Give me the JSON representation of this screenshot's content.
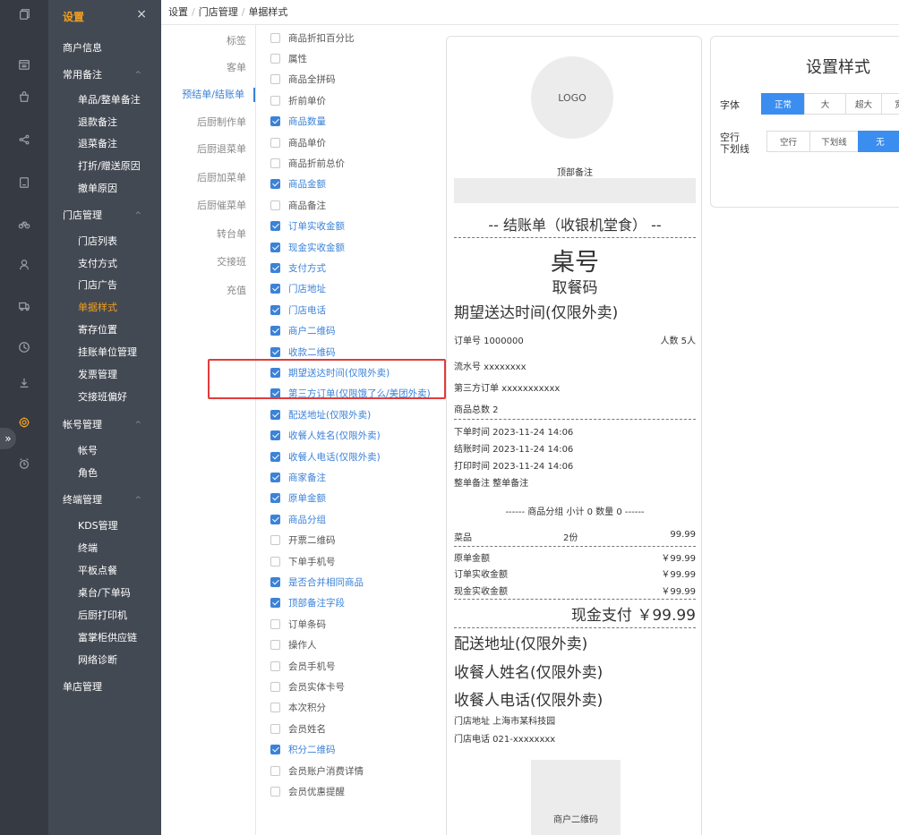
{
  "menu": {
    "title": "设置",
    "close": "×",
    "items": [
      {
        "label": "商户信息",
        "level": "group",
        "caret": "",
        "active": false
      },
      {
        "label": "常用备注",
        "level": "group",
        "caret": "^",
        "active": false
      },
      {
        "label": "单品/整单备注",
        "level": "sub",
        "caret": "",
        "active": false
      },
      {
        "label": "退款备注",
        "level": "sub",
        "caret": "",
        "active": false
      },
      {
        "label": "退菜备注",
        "level": "sub",
        "caret": "",
        "active": false
      },
      {
        "label": "打折/赠送原因",
        "level": "sub",
        "caret": "",
        "active": false
      },
      {
        "label": "撤单原因",
        "level": "sub",
        "caret": "",
        "active": false
      },
      {
        "label": "门店管理",
        "level": "group",
        "caret": "^",
        "active": false
      },
      {
        "label": "门店列表",
        "level": "sub",
        "caret": "",
        "active": false
      },
      {
        "label": "支付方式",
        "level": "sub",
        "caret": "",
        "active": false
      },
      {
        "label": "门店广告",
        "level": "sub",
        "caret": "",
        "active": false
      },
      {
        "label": "单据样式",
        "level": "sub",
        "caret": "",
        "active": true
      },
      {
        "label": "寄存位置",
        "level": "sub",
        "caret": "",
        "active": false
      },
      {
        "label": "挂账单位管理",
        "level": "sub",
        "caret": "",
        "active": false
      },
      {
        "label": "发票管理",
        "level": "sub",
        "caret": "",
        "active": false
      },
      {
        "label": "交接班偏好",
        "level": "sub",
        "caret": "",
        "active": false
      },
      {
        "label": "帐号管理",
        "level": "group",
        "caret": "^",
        "active": false
      },
      {
        "label": "帐号",
        "level": "sub",
        "caret": "",
        "active": false
      },
      {
        "label": "角色",
        "level": "sub",
        "caret": "",
        "active": false
      },
      {
        "label": "终端管理",
        "level": "group",
        "caret": "^",
        "active": false
      },
      {
        "label": "KDS管理",
        "level": "sub",
        "caret": "",
        "active": false
      },
      {
        "label": "终端",
        "level": "sub",
        "caret": "",
        "active": false
      },
      {
        "label": "平板点餐",
        "level": "sub",
        "caret": "",
        "active": false
      },
      {
        "label": "桌台/下单码",
        "level": "sub",
        "caret": "",
        "active": false
      },
      {
        "label": "后厨打印机",
        "level": "sub",
        "caret": "",
        "active": false
      },
      {
        "label": "富掌柜供应链",
        "level": "sub",
        "caret": "",
        "active": false
      },
      {
        "label": "网络诊断",
        "level": "sub",
        "caret": "",
        "active": false
      },
      {
        "label": "单店管理",
        "level": "group",
        "caret": "",
        "active": false
      }
    ]
  },
  "rail": {
    "icons": [
      "copy-icon",
      "calendar-icon",
      "bag-icon",
      "share-icon",
      "bookmark-icon",
      "bike-icon",
      "user-icon",
      "truck-icon",
      "clock-icon",
      "download-icon",
      "gear-icon",
      "alarm-icon"
    ],
    "active_icon": "gear-icon",
    "expander": "»"
  },
  "breadcrumb": [
    "设置",
    "门店管理",
    "单据样式"
  ],
  "tabs": [
    {
      "label": "标签",
      "active": false
    },
    {
      "label": "客单",
      "active": false
    },
    {
      "label": "预结单/结账单",
      "active": true
    },
    {
      "label": "后厨制作单",
      "active": false
    },
    {
      "label": "后厨退菜单",
      "active": false
    },
    {
      "label": "后厨加菜单",
      "active": false
    },
    {
      "label": "后厨催菜单",
      "active": false
    },
    {
      "label": "转台单",
      "active": false
    },
    {
      "label": "交接班",
      "active": false
    },
    {
      "label": "充值",
      "active": false
    }
  ],
  "checklist": [
    {
      "label": "商品折扣百分比",
      "checked": false
    },
    {
      "label": "属性",
      "checked": false
    },
    {
      "label": "商品全拼码",
      "checked": false
    },
    {
      "label": "折前单价",
      "checked": false
    },
    {
      "label": "商品数量",
      "checked": true
    },
    {
      "label": "商品单价",
      "checked": false
    },
    {
      "label": "商品折前总价",
      "checked": false
    },
    {
      "label": "商品金额",
      "checked": true
    },
    {
      "label": "商品备注",
      "checked": false
    },
    {
      "label": "订单实收金额",
      "checked": true
    },
    {
      "label": "现金实收金额",
      "checked": true
    },
    {
      "label": "支付方式",
      "checked": true
    },
    {
      "label": "门店地址",
      "checked": true
    },
    {
      "label": "门店电话",
      "checked": true
    },
    {
      "label": "商户二维码",
      "checked": true
    },
    {
      "label": "收款二维码",
      "checked": true
    },
    {
      "label": "期望送达时间(仅限外卖)",
      "checked": true
    },
    {
      "label": "第三方订单(仅限饿了么/美团外卖)",
      "checked": true
    },
    {
      "label": "配送地址(仅限外卖)",
      "checked": true
    },
    {
      "label": "收餐人姓名(仅限外卖)",
      "checked": true
    },
    {
      "label": "收餐人电话(仅限外卖)",
      "checked": true
    },
    {
      "label": "商家备注",
      "checked": true
    },
    {
      "label": "原单金额",
      "checked": true
    },
    {
      "label": "商品分组",
      "checked": true
    },
    {
      "label": "开票二维码",
      "checked": false
    },
    {
      "label": "下单手机号",
      "checked": false
    },
    {
      "label": "是否合并相同商品",
      "checked": true
    },
    {
      "label": "顶部备注字段",
      "checked": true
    },
    {
      "label": "订单条码",
      "checked": false
    },
    {
      "label": "操作人",
      "checked": false
    },
    {
      "label": "会员手机号",
      "checked": false
    },
    {
      "label": "会员实体卡号",
      "checked": false
    },
    {
      "label": "本次积分",
      "checked": false
    },
    {
      "label": "会员姓名",
      "checked": false
    },
    {
      "label": "积分二维码",
      "checked": true
    },
    {
      "label": "会员账户消费详情",
      "checked": false
    },
    {
      "label": "会员优惠提醒",
      "checked": false
    }
  ],
  "receipt": {
    "logo": "LOGO",
    "top_note": "顶部备注",
    "title": "-- 结账单（收银机堂食） --",
    "table_no": "桌号",
    "pickup_code": "取餐码",
    "expected_time": "期望送达时间(仅限外卖)",
    "order_no": "订单号 1000000",
    "people": "人数 5人",
    "serial": "流水号 xxxxxxxx",
    "third_party": "第三方订单 xxxxxxxxxxx",
    "total_items": "商品总数 2",
    "order_time": "下单时间 2023-11-24 14:06",
    "checkout_time": "结账时间 2023-11-24 14:06",
    "print_time": "打印时间 2023-11-24 14:06",
    "order_note": "整单备注 整单备注",
    "group_line": "------ 商品分组 小计 0 数量 0 ------",
    "item": {
      "name": "菜品",
      "qty": "2份",
      "price": "99.99"
    },
    "amounts": [
      {
        "label": "原单金额",
        "value": "￥99.99"
      },
      {
        "label": "订单实收金额",
        "value": "￥99.99"
      },
      {
        "label": "现金实收金额",
        "value": "￥99.99"
      }
    ],
    "payment": "现金支付 ￥99.99",
    "address": "配送地址(仅限外卖)",
    "recipient_name": "收餐人姓名(仅限外卖)",
    "recipient_phone": "收餐人电话(仅限外卖)",
    "store_address": "门店地址 上海市某科技园",
    "store_phone": "门店电话 021-xxxxxxxx",
    "merchant_qr": "商户二维码"
  },
  "style_panel": {
    "title": "设置样式",
    "font_label": "字体",
    "font_options": [
      "正常",
      "大",
      "超大",
      "宽"
    ],
    "font_selected": "正常",
    "spacing_label": "空行\n下划线",
    "spacing_label_1": "空行",
    "spacing_label_2": "下划线",
    "spacing_options": [
      "空行",
      "下划线",
      "无"
    ],
    "spacing_selected": "无"
  },
  "colors": {
    "accent": "#3b82d8",
    "menu_active": "#f0a020",
    "highlight": "#e23b3b",
    "rail_bg": "#353a43",
    "menu_bg": "#434953"
  }
}
